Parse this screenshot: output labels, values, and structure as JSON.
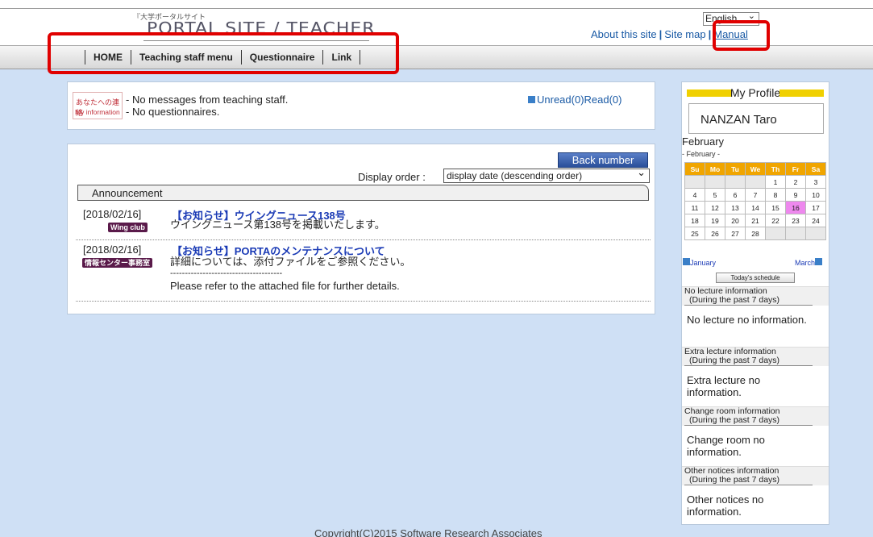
{
  "header": {
    "logo_small": "『大学ポータルサイト",
    "logo_main": "PORTAL SITE / TEACHER",
    "language_select": "English",
    "links": {
      "about": "About this site",
      "sitemap": "Site map",
      "manual": "Manual"
    }
  },
  "nav": {
    "items": [
      "HOME",
      "Teaching staff menu",
      "Questionnaire",
      "Link"
    ]
  },
  "messages": {
    "icon_text_1": "あなたへの連絡",
    "icon_text_2": "My information",
    "line1": "- No messages from teaching staff.",
    "line2": "- No questionnaires.",
    "unread_read": "Unread(0)Read(0)"
  },
  "announcements": {
    "back_number": "Back number",
    "display_order_label": "Display order :",
    "display_order_value": "display date (descending order)",
    "header": "Announcement",
    "items": [
      {
        "date": "[2018/02/16]",
        "badge": "Wing club",
        "title": "【お知らせ】ウイングニュース138号",
        "body": [
          "ウイングニュース第138号を掲載いたします。"
        ]
      },
      {
        "date": "[2018/02/16]",
        "badge": "情報センター事務室",
        "title": "【お知らせ】PORTAのメンテナンスについて",
        "body": [
          "詳細については、添付ファイルをご参照ください。",
          "--------------------------------------",
          "Please refer to the attached file for further details."
        ]
      }
    ]
  },
  "profile": {
    "heading": "My Profile",
    "name": "NANZAN Taro",
    "calendar": {
      "month": "February",
      "sub": "- February -",
      "weekdays": [
        "Su",
        "Mo",
        "Tu",
        "We",
        "Th",
        "Fr",
        "Sa"
      ],
      "today": "16",
      "prev": "January",
      "next": "March",
      "today_button": "Today's schedule"
    },
    "info": [
      {
        "title": "No lecture information",
        "sub": "(During the past 7 days)",
        "body": "No lecture no information."
      },
      {
        "title": "Extra lecture information",
        "sub": "(During the past 7 days)",
        "body": "Extra lecture no information."
      },
      {
        "title": "Change room information",
        "sub": "(During the past 7 days)",
        "body": "Change room no information."
      },
      {
        "title": "Other notices information",
        "sub": "(During the past 7 days)",
        "body": "Other notices no information."
      }
    ]
  },
  "footer": {
    "copyright": "Copyright(C)2015 Software Research Associates"
  },
  "colors": {
    "highlight_box": "#e00000",
    "background": "#cfe0f5",
    "link": "#1a5aa5"
  }
}
